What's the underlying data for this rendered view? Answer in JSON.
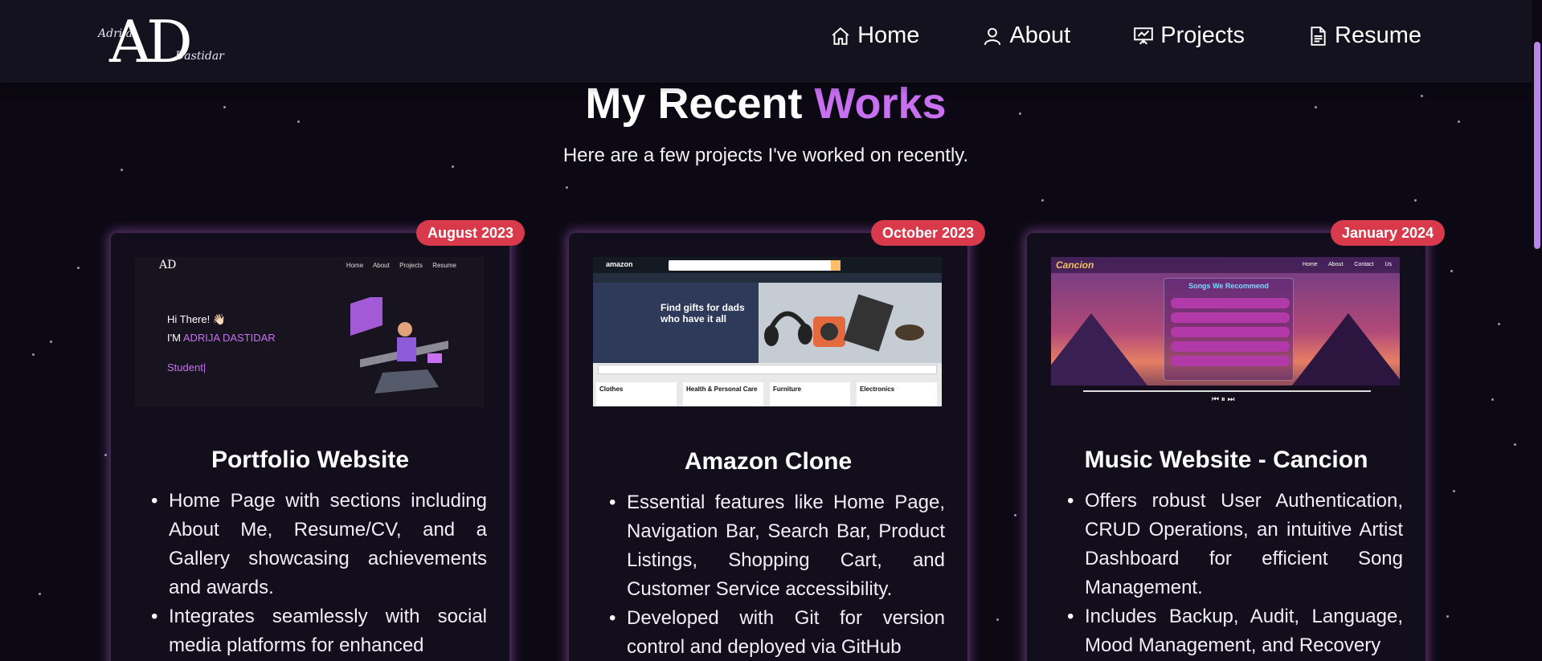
{
  "logo": {
    "initials": "AD",
    "first": "Adrija",
    "last": "Dastidar"
  },
  "nav": [
    {
      "label": "Home",
      "icon": "home-icon"
    },
    {
      "label": "About",
      "icon": "user-icon"
    },
    {
      "label": "Projects",
      "icon": "presentation-icon"
    },
    {
      "label": "Resume",
      "icon": "document-icon"
    }
  ],
  "section": {
    "title_main": "My Recent ",
    "title_accent": "Works",
    "subtitle": "Here are a few projects I've worked on recently."
  },
  "colors": {
    "accent": "#c770f0",
    "badge": "#d83a4b",
    "background": "#0c0914",
    "navbar": "#15121f"
  },
  "projects": [
    {
      "date": "August 2023",
      "title": "Portfolio Website",
      "bullets": [
        "Home Page with sections including About Me, Resume/CV, and a Gallery showcasing achievements and awards.",
        "Integrates seamlessly with social media platforms for enhanced"
      ],
      "thumb": {
        "logo": "AD",
        "nav": "Home About Projects Resume",
        "hi": "Hi There! 👋🏻",
        "im_prefix": "I'M ",
        "im_name": "ADRIJA DASTIDAR",
        "role": "Student|"
      }
    },
    {
      "date": "October 2023",
      "title": "Amazon Clone",
      "bullets": [
        "Essential features like Home Page, Navigation Bar, Search Bar, Product Listings, Shopping Cart, and Customer Service accessibility.",
        "Developed with Git for version control and deployed via GitHub"
      ],
      "thumb": {
        "logo": "amazon",
        "hero": "Find gifts for dads who have it all",
        "boxes": [
          "Clothes",
          "Health & Personal Care",
          "Furniture",
          "Electronics"
        ]
      }
    },
    {
      "date": "January 2024",
      "title": "Music Website - Cancion",
      "bullets": [
        "Offers robust User Authentication, CRUD Operations, an intuitive Artist Dashboard for efficient Song Management.",
        "Includes Backup, Audit, Language, Mood Management, and Recovery"
      ],
      "thumb": {
        "brand": "Cancion",
        "links": "Home About Contact Us",
        "panel_title": "Songs We Recommend",
        "controls": "⏮ ⏸ ⏭"
      }
    }
  ]
}
